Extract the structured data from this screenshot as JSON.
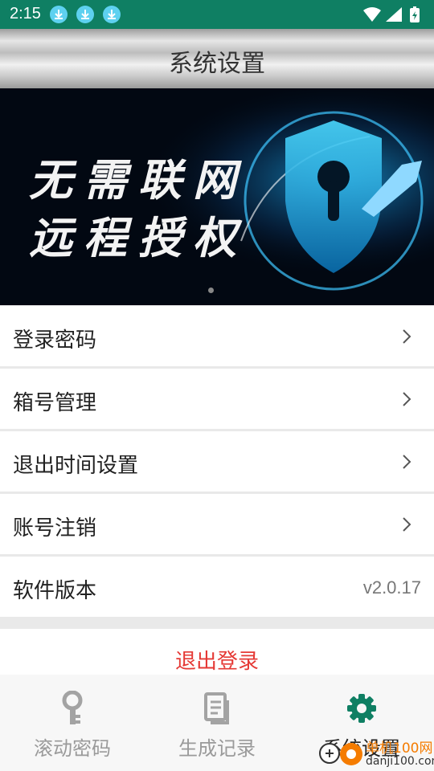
{
  "status_bar": {
    "time": "2:15",
    "download_count": 3
  },
  "header": {
    "title": "系统设置"
  },
  "banner": {
    "line1": "无需联网",
    "line2": "远程授权",
    "slide_count": 1,
    "active_slide": 1
  },
  "menu": [
    {
      "label": "登录密码",
      "has_chevron": true
    },
    {
      "label": "箱号管理",
      "has_chevron": true
    },
    {
      "label": "退出时间设置",
      "has_chevron": true
    },
    {
      "label": "账号注销",
      "has_chevron": true
    },
    {
      "label": "软件版本",
      "value": "v2.0.17"
    }
  ],
  "logout": {
    "label": "退出登录"
  },
  "tabs": [
    {
      "label": "滚动密码",
      "icon": "key-icon",
      "active": false
    },
    {
      "label": "生成记录",
      "icon": "document-icon",
      "active": false
    },
    {
      "label": "系统设置",
      "icon": "gear-icon",
      "active": true
    }
  ],
  "watermark": {
    "text": "单机100网",
    "url_text": "danji100.com"
  },
  "colors": {
    "brand": "#0f7f63",
    "logout": "#e53935",
    "inactive_tab": "#9a9a9a",
    "active_tab": "#222222"
  }
}
